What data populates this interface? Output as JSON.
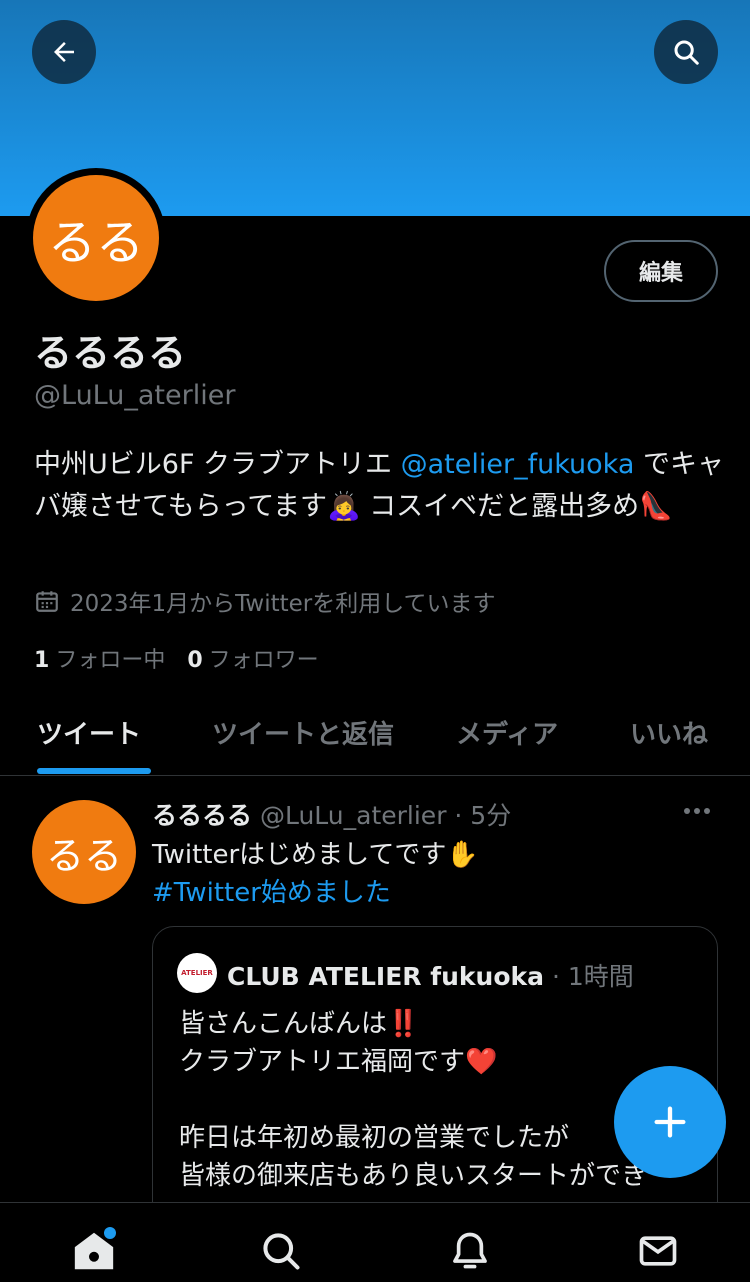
{
  "header": {
    "back_icon": "arrow-left-icon",
    "search_icon": "search-icon"
  },
  "profile": {
    "avatar_text": "るる",
    "edit_label": "編集",
    "display_name": "るるるる",
    "handle": "@LuLu_aterlier",
    "bio_prefix": "中州Uビル6F クラブアトリエ ",
    "bio_mention": "@atelier_fukuoka",
    "bio_suffix": " でキャバ嬢させてもらってます🙇‍♀️ コスイベだと露出多め👠",
    "joined": "2023年1月からTwitterを利用しています",
    "following_count": "1",
    "following_label": "フォロー中",
    "followers_count": "0",
    "followers_label": "フォロワー"
  },
  "tabs": [
    {
      "label": "ツイート"
    },
    {
      "label": "ツイートと返信"
    },
    {
      "label": "メディア"
    },
    {
      "label": "いいね"
    }
  ],
  "tweet": {
    "avatar_text": "るる",
    "name": "るるるる",
    "handle_time": "@LuLu_aterlier · 5分",
    "text": "Twitterはじめましてです✋",
    "hashtag": "#Twitter始めました",
    "quote": {
      "logo_text": "ATELIER",
      "name": "CLUB ATELIER fukuoka",
      "time": " · 1時間",
      "text": "皆さんこんばんは‼️\nクラブアトリエ福岡です❤️\n\n昨日は年初め最初の営業でしたが\n皆様の御来店もあり良いスタートができ"
    }
  },
  "fab_icon": "plus-icon",
  "bottom_nav": [
    {
      "icon": "home-icon"
    },
    {
      "icon": "search-icon"
    },
    {
      "icon": "bell-icon"
    },
    {
      "icon": "mail-icon"
    }
  ],
  "colors": {
    "accent": "#1d9bf0",
    "avatar": "#f07b10",
    "muted": "#71767b"
  }
}
